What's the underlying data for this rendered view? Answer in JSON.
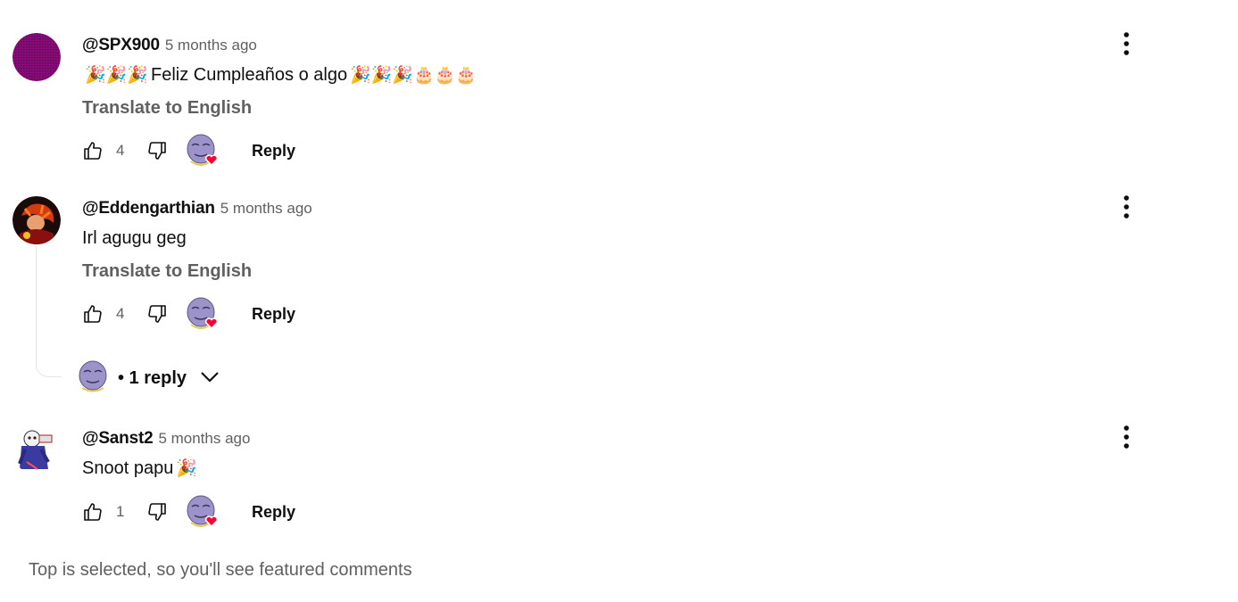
{
  "comments": [
    {
      "author": "@SPX900",
      "time": "5 months ago",
      "text_prefix": "🎉🎉🎉",
      "text": "Feliz Cumpleaños o algo",
      "text_suffix": "🎉🎉🎉🎂🎂🎂",
      "translate": "Translate to English",
      "likes": "4",
      "reply_label": "Reply"
    },
    {
      "author": "@Eddengarthian",
      "time": "5 months ago",
      "text": "Irl agugu geg",
      "translate": "Translate to English",
      "likes": "4",
      "reply_label": "Reply",
      "replies_label": "• 1 reply"
    },
    {
      "author": "@Sanst2",
      "time": "5 months ago",
      "text": "Snoot papu",
      "text_suffix": "🎉",
      "likes": "1",
      "reply_label": "Reply"
    }
  ],
  "footer": "Top is selected, so you'll see featured comments",
  "colors": {
    "heart": "#ff0033",
    "secondary_text": "#606060",
    "creator_avatar": "#9b93c9"
  },
  "icons": [
    "like-icon",
    "dislike-icon",
    "creator-heart-icon",
    "more-vert-icon",
    "chevron-down-icon"
  ]
}
